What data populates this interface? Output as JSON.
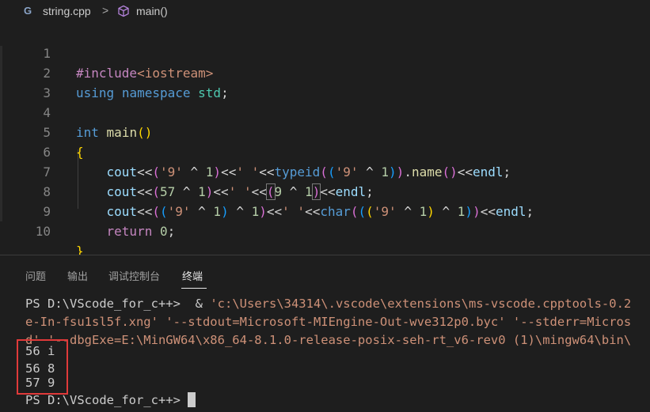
{
  "breadcrumb": {
    "file_icon_glyph": "G",
    "file": "string.cpp",
    "separator": ">",
    "symbol": "main()"
  },
  "editor": {
    "line_numbers": [
      "1",
      "2",
      "3",
      "4",
      "5",
      "6",
      "7",
      "8",
      "9",
      "10"
    ],
    "lines": [
      "#include<iostream>",
      "using namespace std;",
      "",
      "int main()",
      "{",
      "    cout<<('9' ^ 1)<<' '<<typeid(('9' ^ 1)).name()<<endl;",
      "    cout<<(57 ^ 1)<<' '<<(9 ^ 1)<<endl;",
      "    cout<<(('9' ^ 1) ^ 1)<<' '<<char((('9' ^ 1) ^ 1))<<endl;",
      "    return 0;",
      "}"
    ]
  },
  "panel": {
    "tabs": [
      "问题",
      "输出",
      "调试控制台",
      "终端"
    ],
    "active_tab": "终端"
  },
  "terminal": {
    "prompt": "PS D:\\VScode_for_c++>",
    "cmd_line1_op": "&",
    "cmd_line1_arg": "'c:\\Users\\34314\\.vscode\\extensions\\ms-vscode.cpptools-0.2",
    "cmd_line2": "e-In-fsu1sl5f.xng' '--stdout=Microsoft-MIEngine-Out-wve312p0.byc' '--stderr=Micros",
    "cmd_line3": "d' '--dbgExe=E:\\MinGW64\\x86_64-8.1.0-release-posix-seh-rt_v6-rev0 (1)\\mingw64\\bin\\",
    "output": [
      "56 i",
      "56 8",
      "57 9"
    ],
    "prompt_end": "PS D:\\VScode_for_c++>"
  },
  "colors": {
    "background": "#1e1e1e",
    "highlight_box": "#e03a3a",
    "prompt_blue": "#3b8eea"
  }
}
